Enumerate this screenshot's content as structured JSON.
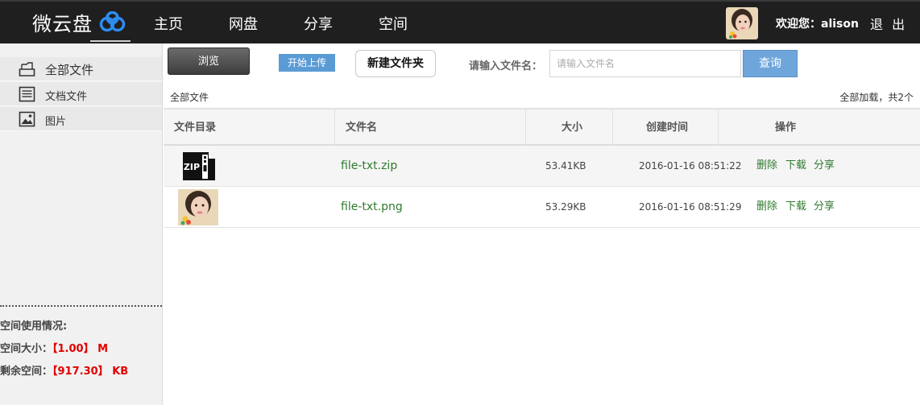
{
  "brand": {
    "name": "微云盘",
    "logo_icon": "cloud-chain-icon"
  },
  "nav": {
    "items": [
      "主页",
      "网盘",
      "分享",
      "空间"
    ]
  },
  "user": {
    "welcome": "欢迎您：alison",
    "logout": "退 出"
  },
  "sidebar": {
    "items": [
      {
        "label": "全部文件",
        "icon": "folder-icon"
      },
      {
        "label": "文档文件",
        "icon": "document-icon"
      },
      {
        "label": "图片",
        "icon": "image-icon"
      }
    ],
    "usage": {
      "title": "空间使用情况:",
      "size_label": "空间大小：",
      "size_value": "【1.00】 M",
      "free_label": "剩余空间：",
      "free_value": "【917.30】 KB"
    }
  },
  "toolbar": {
    "browse": "浏览",
    "upload": "开始上传",
    "new_folder": "新建文件夹",
    "search_label": "请输入文件名：",
    "search_placeholder": "请输入文件名",
    "query": "查询"
  },
  "breadcrumb": {
    "current": "全部文件",
    "summary": "全部加载，共2个"
  },
  "table": {
    "headers": [
      "文件目录",
      "文件名",
      "大小",
      "创建时间",
      "操作"
    ],
    "rows": [
      {
        "name": "file-txt.zip",
        "size": "53.41KB",
        "created": "2016-01-16 08:51:22",
        "thumb": "zip-file-icon",
        "ops": [
          "删除",
          "下载",
          "分享"
        ]
      },
      {
        "name": "file-txt.png",
        "size": "53.29KB",
        "created": "2016-01-16 08:51:29",
        "thumb": "image-thumbnail",
        "ops": [
          "删除",
          "下载",
          "分享"
        ]
      }
    ]
  },
  "colors": {
    "topbar": "#1f1f1f",
    "accent_blue": "#5a9bd5",
    "link_green": "#2f7a2f",
    "usage_red": "#e00000"
  }
}
